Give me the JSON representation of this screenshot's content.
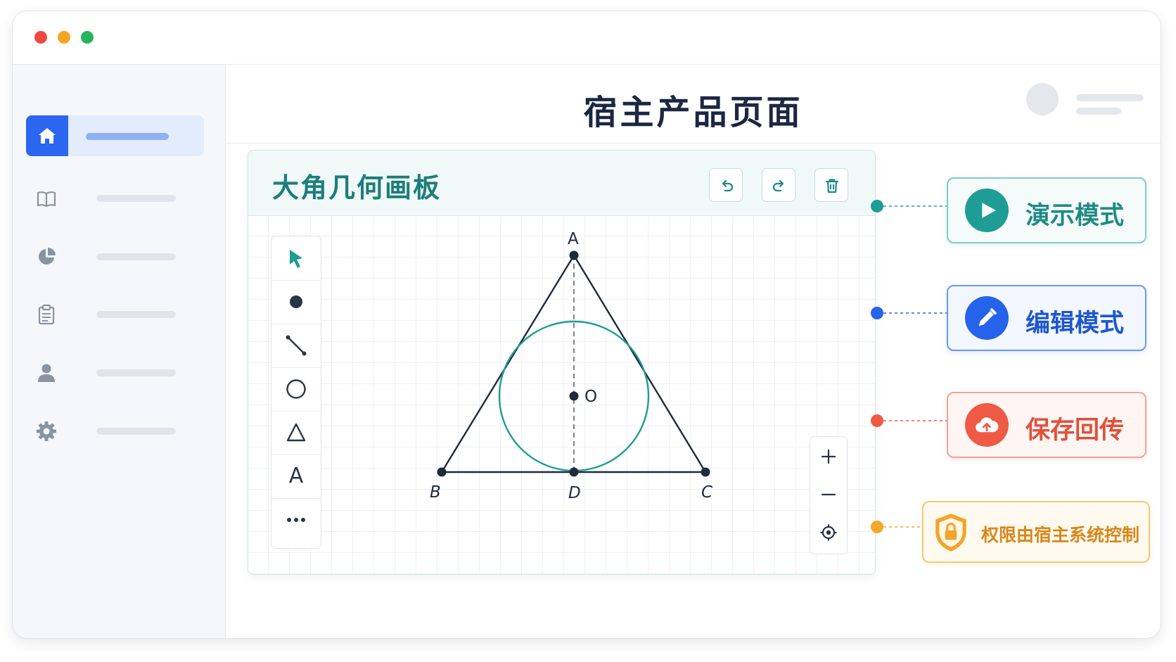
{
  "window": {
    "traffic_lights": [
      {
        "name": "close",
        "color": "#f0483e"
      },
      {
        "name": "minimize",
        "color": "#f5a524"
      },
      {
        "name": "maximize",
        "color": "#26b55c"
      }
    ]
  },
  "sidebar": {
    "items": [
      {
        "icon": "home-icon",
        "active": true
      },
      {
        "icon": "book-icon",
        "active": false
      },
      {
        "icon": "pie-chart-icon",
        "active": false
      },
      {
        "icon": "clipboard-icon",
        "active": false
      },
      {
        "icon": "user-icon",
        "active": false
      },
      {
        "icon": "gear-icon",
        "active": false
      }
    ]
  },
  "header": {
    "title": "宿主产品页面"
  },
  "board": {
    "title": "大角几何画板",
    "toolbar": [
      "undo-icon",
      "redo-icon",
      "trash-icon"
    ],
    "tools": [
      {
        "icon": "pointer-icon"
      },
      {
        "icon": "point-icon"
      },
      {
        "icon": "line-segment-icon"
      },
      {
        "icon": "circle-icon"
      },
      {
        "icon": "triangle-icon"
      },
      {
        "icon": "text-tool",
        "text": "A"
      },
      {
        "icon": "more-icon"
      }
    ],
    "zoom": [
      "zoom-in-icon",
      "zoom-out-icon",
      "locate-icon"
    ],
    "figure": {
      "points": {
        "A": "A",
        "B": "B",
        "C": "C",
        "D": "D",
        "O": "O"
      }
    }
  },
  "modes": [
    {
      "label": "演示模式",
      "icon": "play-icon",
      "color": "#1f9c95"
    },
    {
      "label": "编辑模式",
      "icon": "pencil-icon",
      "color": "#2563eb"
    },
    {
      "label": "保存回传",
      "icon": "cloud-upload-icon",
      "color": "#ef5a45"
    },
    {
      "label": "权限由宿主系统控制",
      "icon": "shield-lock-icon",
      "color": "#f0a92b"
    }
  ]
}
